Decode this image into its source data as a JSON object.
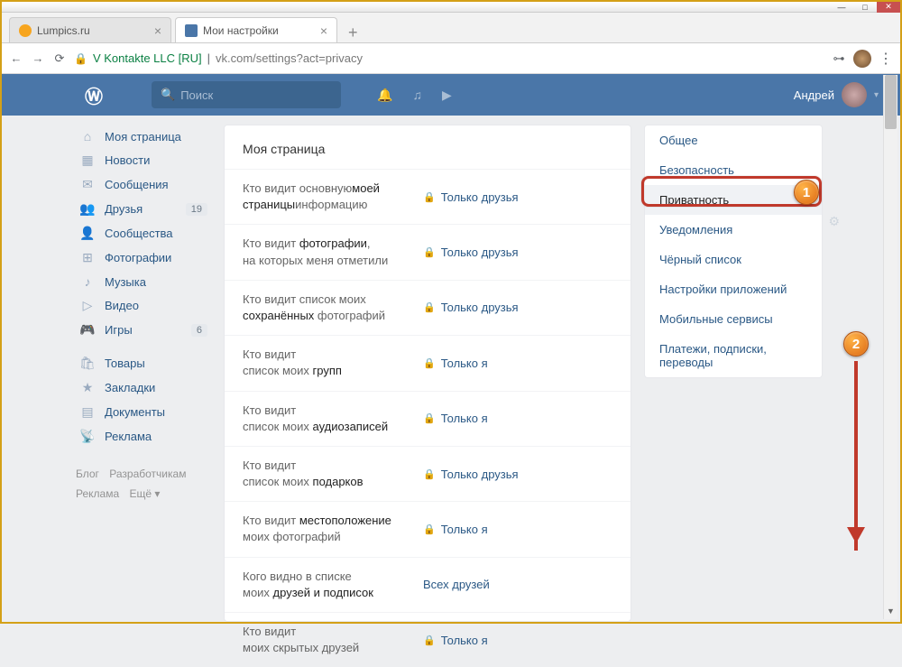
{
  "window": {
    "min": "—",
    "max": "□",
    "close": "✕"
  },
  "tabs": [
    {
      "title": "Lumpics.ru",
      "active": false
    },
    {
      "title": "Мои настройки",
      "active": true
    }
  ],
  "address": {
    "back": "←",
    "fwd": "→",
    "reload": "⟳",
    "lock": "🔒",
    "org": "V Kontakte LLC [RU]",
    "url": "vk.com/settings?act=privacy",
    "key": "⊶",
    "kebab": "⋮"
  },
  "vk": {
    "logo": "Ⓦ",
    "search_placeholder": "Поиск",
    "icons": {
      "bell": "🔔",
      "music": "♫",
      "play": "▶"
    },
    "user": "Андрей"
  },
  "leftnav": [
    {
      "icon": "⌂",
      "label": "Моя страница"
    },
    {
      "icon": "▦",
      "label": "Новости"
    },
    {
      "icon": "✉",
      "label": "Сообщения"
    },
    {
      "icon": "👥",
      "label": "Друзья",
      "badge": "19"
    },
    {
      "icon": "👤",
      "label": "Сообщества"
    },
    {
      "icon": "⊞",
      "label": "Фотографии"
    },
    {
      "icon": "♪",
      "label": "Музыка"
    },
    {
      "icon": "▷",
      "label": "Видео"
    },
    {
      "icon": "🎮",
      "label": "Игры",
      "badge": "6"
    }
  ],
  "leftnav2": [
    {
      "icon": "🛍",
      "label": "Товары"
    },
    {
      "icon": "★",
      "label": "Закладки"
    },
    {
      "icon": "▤",
      "label": "Документы"
    },
    {
      "icon": "📡",
      "label": "Реклама"
    }
  ],
  "footer": {
    "a": "Блог",
    "b": "Разработчикам",
    "c": "Реклама",
    "d": "Ещё ▾"
  },
  "settings": {
    "title": "Моя страница",
    "rows": [
      {
        "t1": "Кто видит основную",
        "t2": "информацию ",
        "b": "моей страницы",
        "val": "Только друзья",
        "lock": true
      },
      {
        "t1": "Кто видит ",
        "b": "фотографии",
        "t2": ",\nна которых меня отметили",
        "val": "Только друзья",
        "lock": true
      },
      {
        "t1": "Кто видит список моих\n",
        "b": "сохранённых",
        "t2": " фотографий",
        "val": "Только друзья",
        "lock": true
      },
      {
        "t1": "Кто видит\nсписок моих ",
        "b": "групп",
        "t2": "",
        "val": "Только я",
        "lock": true
      },
      {
        "t1": "Кто видит\nсписок моих ",
        "b": "аудиозаписей",
        "t2": "",
        "val": "Только я",
        "lock": true
      },
      {
        "t1": "Кто видит\nсписок моих ",
        "b": "подарков",
        "t2": "",
        "val": "Только друзья",
        "lock": true
      },
      {
        "t1": "Кто видит ",
        "b": "местоположение",
        "t2": "\nмоих фотографий",
        "val": "Только я",
        "lock": true
      },
      {
        "t1": "Кого видно в списке\nмоих ",
        "b": "друзей и подписок",
        "t2": "",
        "val": "Всех друзей",
        "lock": false
      },
      {
        "t1": "Кто видит\nмоих скрытых друзей",
        "b": "",
        "t2": "",
        "val": "Только я",
        "lock": true
      }
    ]
  },
  "rightnav": [
    "Общее",
    "Безопасность",
    "Приватность",
    "Уведомления",
    "Чёрный список",
    "Настройки приложений",
    "Мобильные сервисы",
    "Платежи, подписки, переводы"
  ],
  "markers": {
    "one": "1",
    "two": "2"
  }
}
